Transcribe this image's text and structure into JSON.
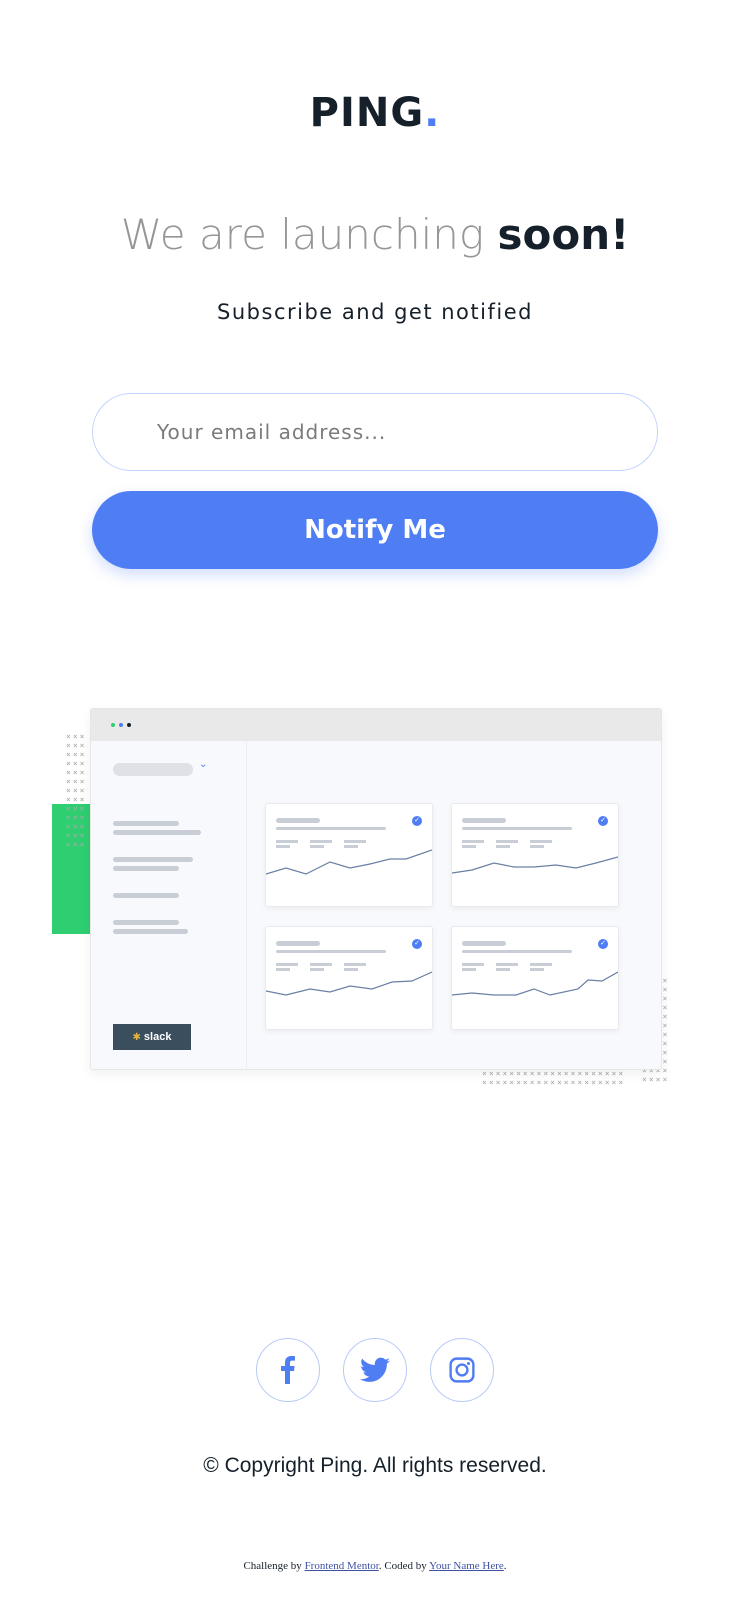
{
  "logo": {
    "text": "PING",
    "dot": "."
  },
  "hero": {
    "headline_light": "We are launching",
    "headline_bold": "soon!",
    "subtitle": "Subscribe and get notified"
  },
  "form": {
    "email_placeholder": "Your email address...",
    "email_value": "",
    "button_label": "Notify Me"
  },
  "illustration": {
    "slack_label": "slack"
  },
  "social": {
    "items": [
      {
        "name": "facebook",
        "icon": "facebook-icon"
      },
      {
        "name": "twitter",
        "icon": "twitter-icon"
      },
      {
        "name": "instagram",
        "icon": "instagram-icon"
      }
    ]
  },
  "footer": {
    "copyright": "© Copyright Ping. All rights reserved.",
    "challenge_prefix": "Challenge by",
    "challenge_link": "Frontend Mentor",
    "coded_prefix": ". Coded by",
    "coded_link": "Your Name Here",
    "end": "."
  },
  "colors": {
    "accent": "#4f7df3",
    "dark": "#15202a",
    "gray": "#969696",
    "green": "#2fce71"
  }
}
